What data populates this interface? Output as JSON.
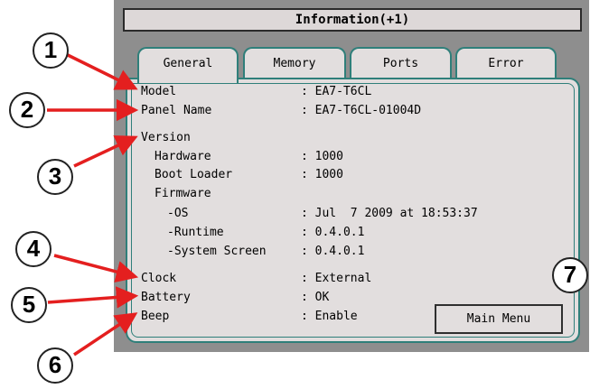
{
  "window": {
    "title": "Information(+1)"
  },
  "tabs": [
    {
      "label": "General",
      "active": true
    },
    {
      "label": "Memory",
      "active": false
    },
    {
      "label": "Ports",
      "active": false
    },
    {
      "label": "Error",
      "active": false
    }
  ],
  "fields": {
    "model": {
      "label": "Model",
      "value": ": EA7-T6CL"
    },
    "panel_name": {
      "label": "Panel Name",
      "value": ": EA7-T6CL-01004D"
    },
    "version": {
      "label": "Version"
    },
    "hardware": {
      "label": "Hardware",
      "value": ": 1000"
    },
    "boot_loader": {
      "label": "Boot Loader",
      "value": ": 1000"
    },
    "firmware": {
      "label": "Firmware"
    },
    "os": {
      "label": "-OS",
      "value": ": Jul  7 2009 at 18:53:37"
    },
    "runtime": {
      "label": "-Runtime",
      "value": ": 0.4.0.1"
    },
    "system_screen": {
      "label": "-System Screen",
      "value": ": 0.4.0.1"
    },
    "clock": {
      "label": "Clock",
      "value": ": External"
    },
    "battery": {
      "label": "Battery",
      "value": ": OK"
    },
    "beep": {
      "label": "Beep",
      "value": ": Enable"
    }
  },
  "main_menu_label": "Main Menu",
  "callouts": [
    "1",
    "2",
    "3",
    "4",
    "5",
    "6",
    "7"
  ],
  "colors": {
    "panel_bg": "#8e8e8e",
    "screen_bg": "#e2dede",
    "tab_border": "#2f7f7a",
    "arrow": "#e41f1f"
  }
}
